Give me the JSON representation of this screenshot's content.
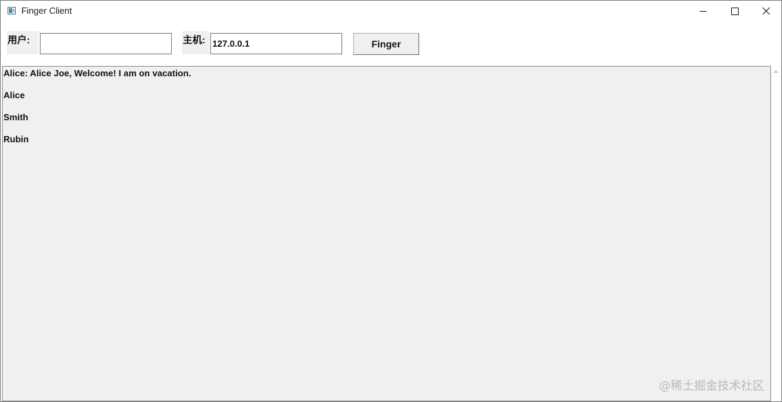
{
  "window": {
    "title": "Finger Client",
    "icon": "app-window-icon",
    "controls": [
      "minimize-icon",
      "maximize-icon",
      "close-icon"
    ]
  },
  "form": {
    "user_label": "用户:",
    "user_value": "",
    "host_label": "主机:",
    "host_value": "127.0.0.1",
    "finger_button_label": "Finger"
  },
  "output": {
    "lines": [
      "Alice: Alice Joe, Welcome! I am on vacation.",
      "Alice",
      "Smith",
      "Rubin"
    ]
  },
  "watermark": "@稀土掘金技术社区",
  "colors": {
    "output_background": "#f0f0f0",
    "window_background": "#ffffff",
    "watermark": "#b9b9b9"
  }
}
